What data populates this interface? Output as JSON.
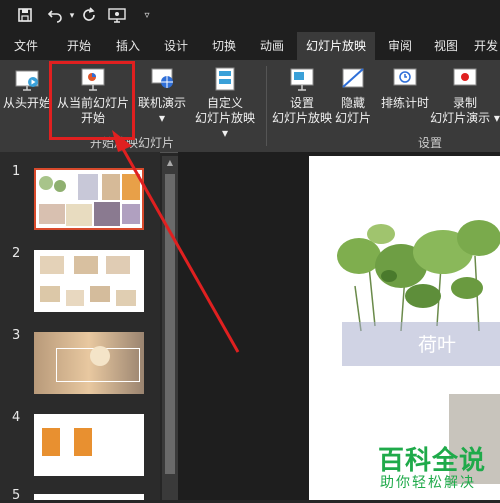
{
  "quick_access": {
    "icons": [
      "save-icon",
      "undo-icon",
      "redo-icon",
      "present-icon",
      "customize-icon"
    ]
  },
  "tabs": [
    {
      "label": "文件"
    },
    {
      "label": "开始"
    },
    {
      "label": "插入"
    },
    {
      "label": "设计"
    },
    {
      "label": "切换"
    },
    {
      "label": "动画"
    },
    {
      "label": "幻灯片放映",
      "active": true
    },
    {
      "label": "审阅"
    },
    {
      "label": "视图"
    },
    {
      "label": "开发"
    }
  ],
  "ribbon": {
    "from_beginning": "从头开始",
    "from_current_line1": "从当前幻灯片",
    "from_current_line2": "开始",
    "online_present": "联机演示",
    "custom_show_line1": "自定义",
    "custom_show_line2": "幻灯片放映",
    "group1_label": "开始放映幻灯片",
    "setup_line1": "设置",
    "setup_line2": "幻灯片放映",
    "hide_line1": "隐藏",
    "hide_line2": "幻灯片",
    "rehearse": "排练计时",
    "record_line1": "录制",
    "record_line2": "幻灯片演示",
    "group2_label": "设置"
  },
  "slides": [
    {
      "number": "1"
    },
    {
      "number": "2"
    },
    {
      "number": "3"
    },
    {
      "number": "4"
    },
    {
      "number": "5"
    }
  ],
  "current_slide": {
    "caption": "荷叶"
  },
  "watermark": {
    "title": "百科全说",
    "subtitle": "助你轻松解决"
  },
  "colors": {
    "accent_red": "#e02020",
    "selection": "#d84a2c",
    "watermark_green": "#1faa4a"
  }
}
